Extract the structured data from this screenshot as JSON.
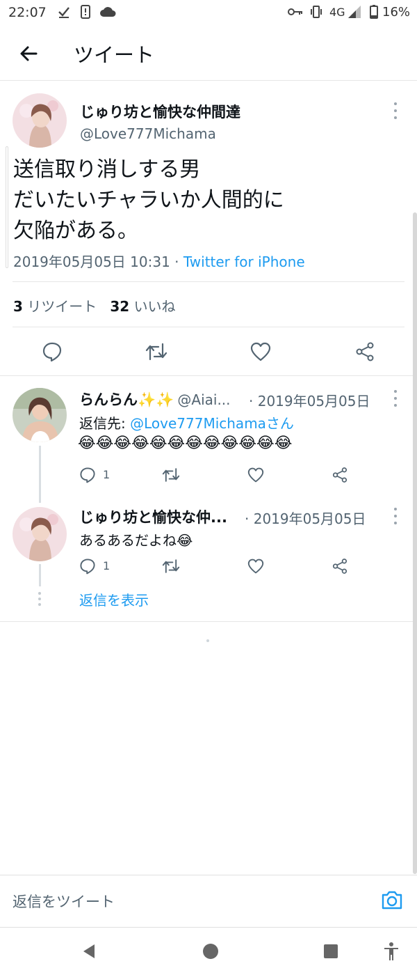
{
  "status_bar": {
    "time": "22:07",
    "network": "4G",
    "battery": "16%",
    "icons": [
      "check-icon",
      "phone-icon",
      "cloud-icon",
      "key-icon",
      "vibrate-icon",
      "signal-icon",
      "battery-icon"
    ]
  },
  "header": {
    "title": "ツイート"
  },
  "tweet": {
    "name": "じゅり坊と愉快な仲間達",
    "handle": "@Love777Michama",
    "lines": [
      "送信取り消しする男",
      "だいたいチャラいか人間的に",
      "欠陥がある。"
    ],
    "timestamp": "2019年05月05日 10:31 · ",
    "source": "Twitter for iPhone",
    "retweets": "3",
    "retweets_label": "リツイート",
    "likes": "32",
    "likes_label": "いいね"
  },
  "replies": [
    {
      "name": "らんらん✨✨",
      "handle": "@Aiai...",
      "date": "· 2019年05月05日",
      "reply_to_prefix": "返信先: ",
      "reply_to": "@Love777Michamaさん",
      "text": "😂😂😂😂😂😂😂😂😂😂😂😂",
      "reply_count": "1"
    },
    {
      "name": "じゅり坊と愉快な仲...",
      "date": "· 2019年05月05日",
      "text": "あるあるだよね😂",
      "reply_count": "1",
      "show_replies": "返信を表示"
    }
  ],
  "composer": {
    "placeholder": "返信をツイート"
  },
  "colors": {
    "accent": "#1d9bf0",
    "text": "#0f1419",
    "secondary": "#536471"
  }
}
